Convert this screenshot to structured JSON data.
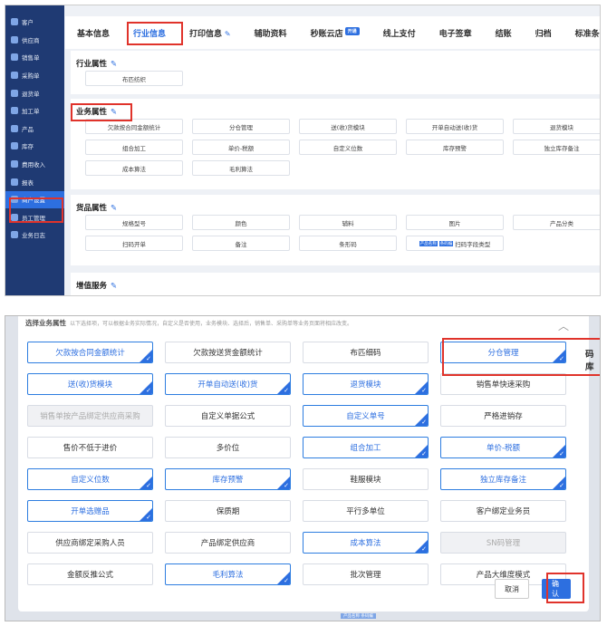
{
  "sidebar": {
    "items": [
      {
        "label": "客户",
        "icon": "customer-icon"
      },
      {
        "label": "供应商",
        "icon": "supplier-icon"
      },
      {
        "label": "销售单",
        "icon": "sales-order-icon"
      },
      {
        "label": "采购单",
        "icon": "purchase-order-icon"
      },
      {
        "label": "退货单",
        "icon": "return-order-icon"
      },
      {
        "label": "加工单",
        "icon": "process-order-icon"
      },
      {
        "label": "产品",
        "icon": "product-icon"
      },
      {
        "label": "库存",
        "icon": "inventory-icon"
      },
      {
        "label": "费用收入",
        "icon": "expense-icon"
      },
      {
        "label": "报表",
        "icon": "report-icon"
      },
      {
        "label": "商户设置",
        "icon": "settings-icon"
      },
      {
        "label": "员工管理",
        "icon": "staff-icon"
      },
      {
        "label": "业务日志",
        "icon": "log-icon"
      }
    ],
    "active_index": 10
  },
  "tabs": [
    {
      "label": "基本信息"
    },
    {
      "label": "行业信息"
    },
    {
      "label": "打印信息"
    },
    {
      "label": "辅助资料"
    },
    {
      "label": "秒账云店",
      "badge": "开通"
    },
    {
      "label": "线上支付"
    },
    {
      "label": "电子签章"
    },
    {
      "label": "结账"
    },
    {
      "label": "归档"
    },
    {
      "label": "标准条码库"
    }
  ],
  "industry": {
    "title": "行业属性",
    "items": [
      "布匹纺织"
    ]
  },
  "business": {
    "title": "业务属性",
    "items": [
      "欠款按合同金额统计",
      "分仓管理",
      "送(收)货模块",
      "开单自动送(收)货",
      "退货模块",
      "组合加工",
      "单价-税额",
      "自定义位数",
      "库存预警",
      "独立库存备注",
      "成本算法",
      "毛利算法"
    ]
  },
  "goods": {
    "title": "货品属性",
    "items": [
      "规格型号",
      "颜色",
      "辅料",
      "图片",
      "产品分类",
      "扫码开单",
      "备注",
      "条形码",
      "扫码字段类型"
    ],
    "badges": [
      "产品名称",
      "条码编"
    ]
  },
  "valueadd": {
    "title": "增值服务"
  },
  "dialog": {
    "title": "选择业务属性",
    "subtitle": "以下选择项，可以根据业务实际情况，自定义是否使用，业务模块、选择后，销售单、采购单等业务页面将相应改变。",
    "options": [
      {
        "label": "欠款按合同金额统计",
        "state": "selected"
      },
      {
        "label": "欠款按送货金额统计",
        "state": "normal"
      },
      {
        "label": "布匹细码",
        "state": "normal"
      },
      {
        "label": "分仓管理",
        "state": "selected"
      },
      {
        "label": "送(收)货模块",
        "state": "selected"
      },
      {
        "label": "开单自动送(收)货",
        "state": "selected"
      },
      {
        "label": "退货模块",
        "state": "selected"
      },
      {
        "label": "销售单快速采购",
        "state": "normal"
      },
      {
        "label": "销售单按产品绑定供应商采购",
        "state": "disabled"
      },
      {
        "label": "自定义单据公式",
        "state": "normal"
      },
      {
        "label": "自定义单号",
        "state": "selected"
      },
      {
        "label": "严格进销存",
        "state": "normal"
      },
      {
        "label": "售价不低于进价",
        "state": "normal"
      },
      {
        "label": "多价位",
        "state": "normal"
      },
      {
        "label": "组合加工",
        "state": "selected"
      },
      {
        "label": "单价-税额",
        "state": "selected"
      },
      {
        "label": "自定义位数",
        "state": "selected"
      },
      {
        "label": "库存预警",
        "state": "selected"
      },
      {
        "label": "鞋服模块",
        "state": "normal"
      },
      {
        "label": "独立库存备注",
        "state": "selected"
      },
      {
        "label": "开单选赠品",
        "state": "selected"
      },
      {
        "label": "保质期",
        "state": "normal"
      },
      {
        "label": "平行多单位",
        "state": "normal"
      },
      {
        "label": "客户绑定业务员",
        "state": "normal"
      },
      {
        "label": "供应商绑定采购人员",
        "state": "normal"
      },
      {
        "label": "产品绑定供应商",
        "state": "normal"
      },
      {
        "label": "成本算法",
        "state": "selected"
      },
      {
        "label": "SN码管理",
        "state": "disabled"
      },
      {
        "label": "金额反推公式",
        "state": "normal"
      },
      {
        "label": "毛利算法",
        "state": "selected"
      },
      {
        "label": "批次管理",
        "state": "normal"
      },
      {
        "label": "产品大维度模式",
        "state": "normal"
      }
    ],
    "side_text": "码库",
    "cancel_label": "取消",
    "ok_label": "确认",
    "check_glyph": "✓"
  },
  "bottom_strip_label": "产品名称 条码编",
  "colors": {
    "primary": "#2d6fe0",
    "sidebar_bg": "#1f3a73",
    "highlight_red": "#e0332b"
  }
}
